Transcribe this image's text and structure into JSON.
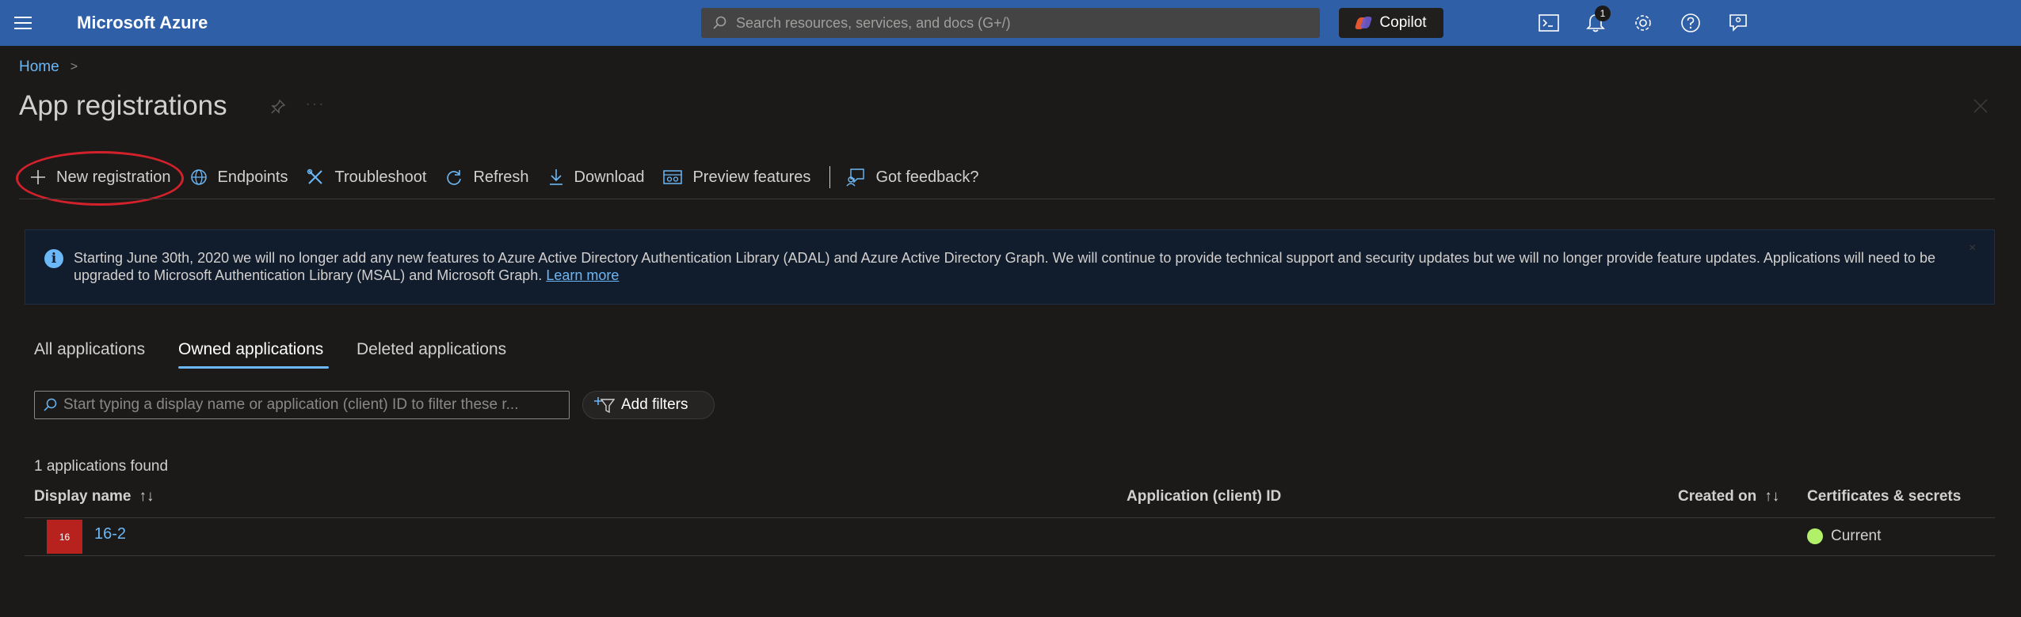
{
  "topbar": {
    "brand": "Microsoft Azure",
    "search_placeholder": "Search resources, services, and docs (G+/)",
    "copilot_label": "Copilot",
    "notification_count": "1",
    "icons": [
      "menu-icon",
      "search-icon",
      "copilot-icon",
      "cloud-shell-icon",
      "bell-icon",
      "gear-icon",
      "help-icon",
      "feedback-icon"
    ],
    "bar_color": "#2f5fa7"
  },
  "breadcrumb": {
    "home": "Home",
    "separator": ">"
  },
  "page": {
    "title": "App registrations",
    "more": "···",
    "close": "×"
  },
  "toolbar": {
    "new_registration": "New registration",
    "endpoints": "Endpoints",
    "troubleshoot": "Troubleshoot",
    "refresh": "Refresh",
    "download": "Download",
    "preview_features": "Preview features",
    "feedback": "Got feedback?"
  },
  "banner": {
    "text": "Starting June 30th, 2020 we will no longer add any new features to Azure Active Directory Authentication Library (ADAL) and Azure Active Directory Graph. We will continue to provide technical support and security updates but we will no longer provide feature updates. Applications will need to be upgraded to Microsoft Authentication Library (MSAL) and Microsoft Graph.",
    "link": "Learn more",
    "info_glyph": "i",
    "close": "×"
  },
  "tabs": [
    {
      "label": "All applications",
      "active": false
    },
    {
      "label": "Owned applications",
      "active": true
    },
    {
      "label": "Deleted applications",
      "active": false
    }
  ],
  "filter": {
    "placeholder": "Start typing a display name or application (client) ID to filter these r...",
    "add_filters": "Add filters"
  },
  "results": {
    "count_text": "1 applications found",
    "columns": {
      "display_name": "Display name",
      "app_id": "Application (client) ID",
      "created_on": "Created on",
      "certs": "Certificates & secrets"
    },
    "sort_glyph": "↑↓",
    "rows": [
      {
        "icon_text": "16",
        "name": "16-2",
        "app_id": "",
        "created_on": "",
        "cert_status": "Current",
        "icon_color": "#b7221f",
        "status_color": "#b3f06a"
      }
    ]
  },
  "colors": {
    "accent": "#6cb8f6",
    "background": "#1b1a19",
    "annotation": "#d3212b"
  }
}
